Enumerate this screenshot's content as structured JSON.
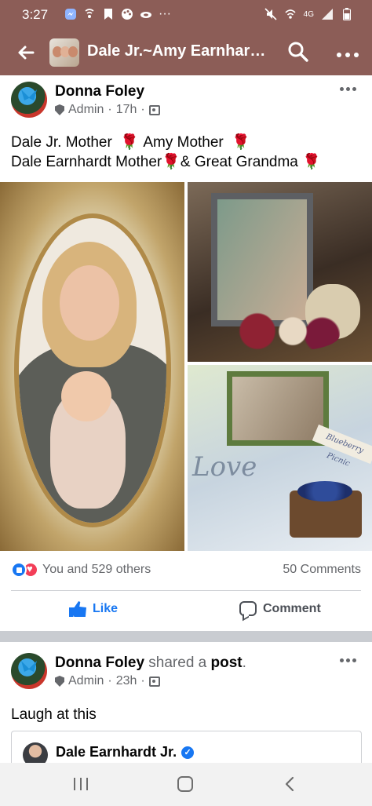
{
  "status_bar": {
    "time": "3:27",
    "network": "4G",
    "icons": [
      "messenger-icon",
      "wifi-call-icon",
      "bookmark-icon",
      "palette-icon",
      "cloud-icon",
      "more-dots-icon",
      "mute-icon",
      "hotspot-icon",
      "signal-icon",
      "battery-icon"
    ]
  },
  "app_bar": {
    "title": "Dale Jr.~Amy Earnhar…",
    "back_icon": "back-arrow-icon",
    "search_icon": "search-icon",
    "more_icon": "more-dots-icon"
  },
  "post1": {
    "author": "Donna Foley",
    "role": "Admin",
    "time": "17h",
    "line1": {
      "a": "Dale Jr. Mother",
      "b": "Amy Mother"
    },
    "line2": {
      "a": "Dale Earnhardt Mother",
      "b": "& Great Grandma"
    },
    "photo3_tag": "Blueberry Picnic",
    "photo3_script": "Love",
    "reactions_text": "You and 529 others",
    "comments_text": "50 Comments",
    "like_label": "Like",
    "comment_label": "Comment"
  },
  "post2": {
    "author": "Donna Foley",
    "shared": "shared a",
    "post_word": "post",
    "period": ".",
    "role": "Admin",
    "time": "23h",
    "text": "Laugh at this",
    "quoted_author": "Dale Earnhardt Jr."
  },
  "colors": {
    "header": "#8c5d57",
    "facebook_blue": "#1877f2",
    "love_red": "#f33e58",
    "meta_gray": "#65676b"
  }
}
